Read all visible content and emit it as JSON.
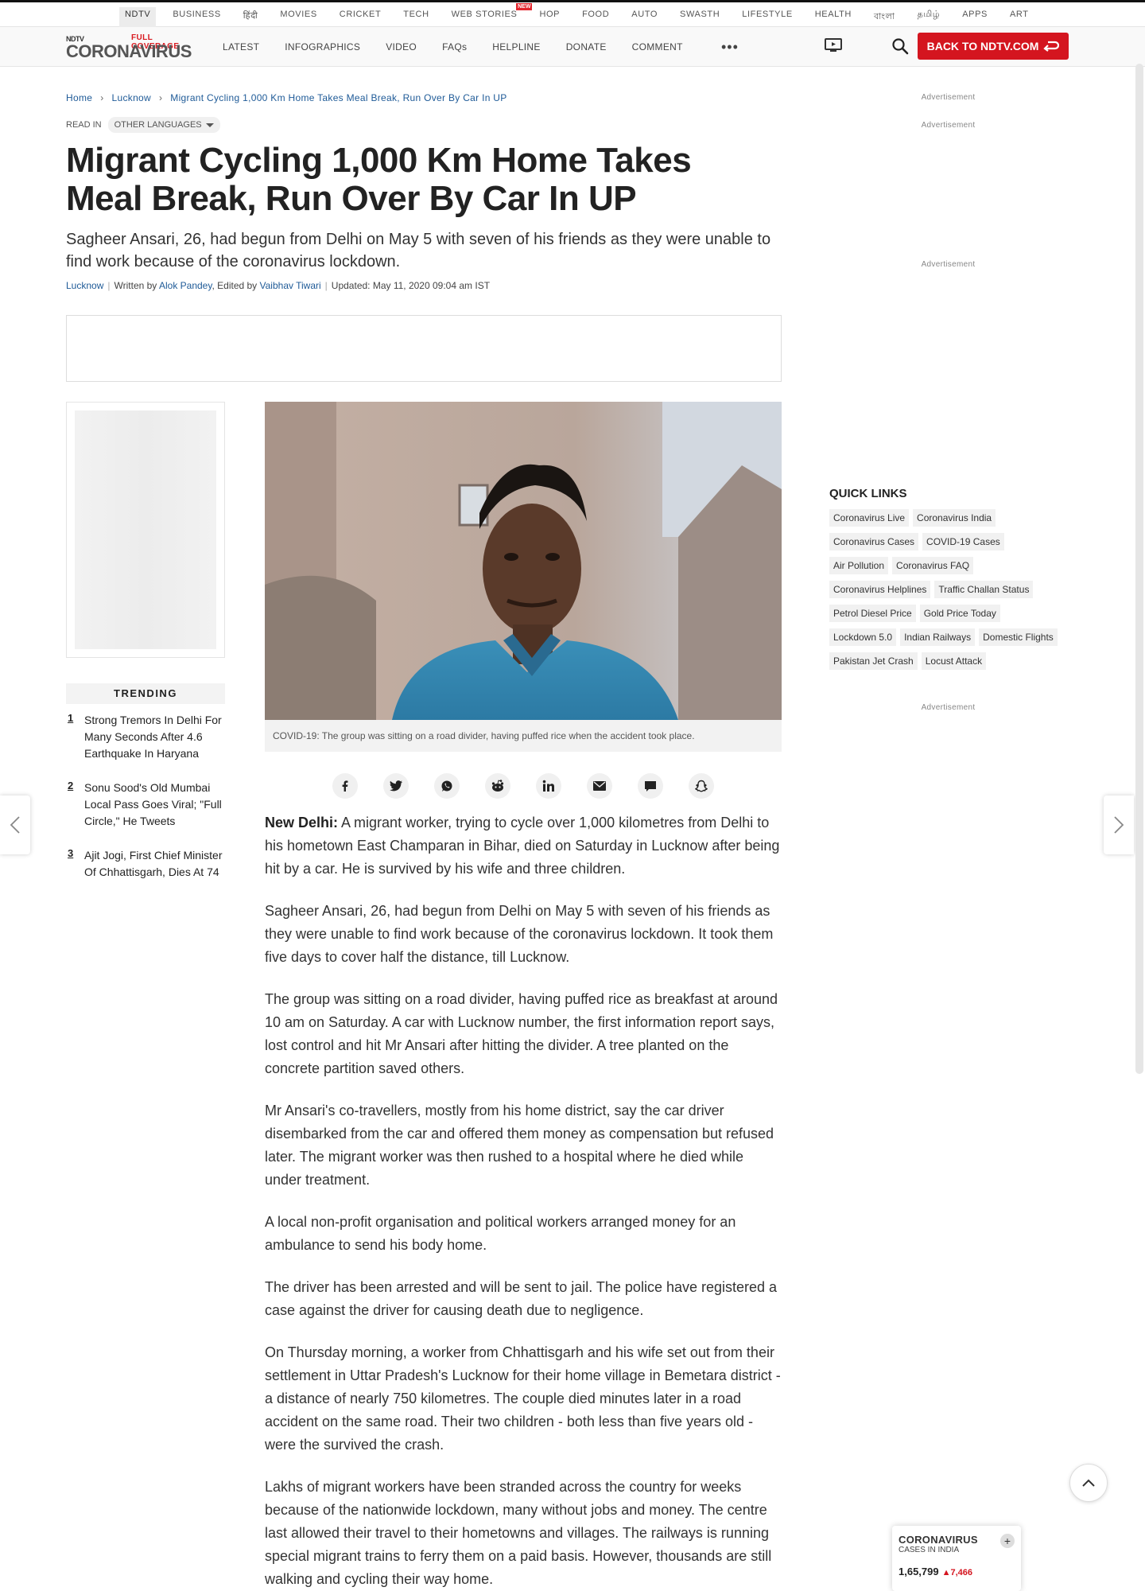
{
  "network_nav": [
    {
      "label": "NDTV",
      "active": true
    },
    {
      "label": "BUSINESS"
    },
    {
      "label": "हिंदी"
    },
    {
      "label": "MOVIES"
    },
    {
      "label": "CRICKET"
    },
    {
      "label": "TECH"
    },
    {
      "label": "WEB STORIES",
      "badge": "NEW"
    },
    {
      "label": "HOP"
    },
    {
      "label": "FOOD"
    },
    {
      "label": "AUTO"
    },
    {
      "label": "SWASTH"
    },
    {
      "label": "LIFESTYLE"
    },
    {
      "label": "HEALTH"
    },
    {
      "label": "বাংলা"
    },
    {
      "label": "தமிழ்"
    },
    {
      "label": "APPS"
    },
    {
      "label": "ART"
    }
  ],
  "header": {
    "logo_ndtv": "NDTV",
    "logo_text": "CORONAVIRUS",
    "logo_tag": "FULL COVERAGE",
    "nav": [
      "LATEST",
      "INFOGRAPHICS",
      "VIDEO",
      "FAQs",
      "HELPLINE",
      "DONATE",
      "COMMENT"
    ],
    "more": "•••",
    "back_button": "BACK TO NDTV.COM"
  },
  "breadcrumb": [
    "Home",
    "Lucknow",
    "Migrant Cycling 1,000 Km Home Takes Meal Break, Run Over By Car In UP"
  ],
  "read_in": {
    "label": "READ IN",
    "dropdown": "OTHER LANGUAGES"
  },
  "article": {
    "headline": "Migrant Cycling 1,000 Km Home Takes Meal Break, Run Over By Car In UP",
    "standfirst": "Sagheer Ansari, 26, had begun from Delhi on May 5 with seven of his friends as they were unable to find work because of the coronavirus lockdown.",
    "byline": {
      "location": "Lucknow",
      "written_prefix": "Written by",
      "author": "Alok Pandey",
      "edited_prefix": ", Edited by",
      "editor": "Vaibhav Tiwari",
      "updated": "Updated: May 11, 2020 09:04 am IST"
    },
    "image_caption": "COVID-19: The group was sitting on a road divider, having puffed rice when the accident took place.",
    "dateline": "New Delhi:",
    "first_paragraph": "A migrant worker, trying to cycle over 1,000 kilometres from Delhi to his hometown East Champaran in Bihar, died on Saturday in Lucknow after being hit by a car. He is survived by his wife and three children.",
    "paragraphs": [
      "Sagheer Ansari, 26, had begun from Delhi on May 5 with seven of his friends as they were unable to find work because of the coronavirus lockdown. It took them five days to cover half the distance, till Lucknow.",
      "The group was sitting on a road divider, having puffed rice as breakfast at around 10 am on Saturday. A car with Lucknow number, the first information report says, lost control and hit Mr Ansari after hitting the divider. A tree planted on the concrete partition saved others.",
      "Mr Ansari's co-travellers, mostly from his home district, say the car driver disembarked from the car and offered them money as compensation but refused later. The migrant worker was then rushed to a hospital where he died while under treatment.",
      "A local non-profit organisation and political workers arranged money for an ambulance to send his body home.",
      "The driver has been arrested and will be sent to jail. The police have registered a case against the driver for causing death due to negligence.",
      "On Thursday morning, a worker from Chhattisgarh and his wife set out from their settlement in Uttar Pradesh's Lucknow for their home village in Bemetara district - a distance of nearly 750 kilometres.  The couple died minutes later in a road accident on the same road. Their two children - both less than five years old - were the survived the crash.",
      "Lakhs of migrant workers have been stranded across the country for weeks because of the nationwide lockdown, many without jobs and money. The centre last allowed their travel to their hometowns and villages. The railways is running special migrant trains to ferry them on a paid basis. However, thousands are still walking and cycling their way home."
    ]
  },
  "share_icons": [
    "facebook-icon",
    "twitter-icon",
    "whatsapp-icon",
    "reddit-icon",
    "linkedin-icon",
    "email-icon",
    "comment-icon",
    "snapchat-icon"
  ],
  "trending": {
    "title": "TRENDING",
    "items": [
      {
        "num": "1",
        "text": "Strong Tremors In Delhi For Many Seconds After 4.6 Earthquake In Haryana"
      },
      {
        "num": "2",
        "text": "Sonu Sood's Old Mumbai Local Pass Goes Viral; \"Full Circle,\" He Tweets"
      },
      {
        "num": "3",
        "text": "Ajit Jogi, First Chief Minister Of Chhattisgarh, Dies At 74"
      }
    ]
  },
  "sidebar": {
    "ad_label": "Advertisement",
    "quick_links_title": "QUICK LINKS",
    "quick_links": [
      "Coronavirus Live",
      "Coronavirus India",
      "Coronavirus Cases",
      "COVID-19 Cases",
      "Air Pollution",
      "Coronavirus FAQ",
      "Coronavirus Helplines",
      "Traffic Challan Status",
      "Petrol Diesel Price",
      "Gold Price Today",
      "Lockdown 5.0",
      "Indian Railways",
      "Domestic Flights",
      "Pakistan Jet Crash",
      "Locust Attack"
    ]
  },
  "covid_widget": {
    "title": "CORONAVIRUS",
    "subtitle": "CASES IN INDIA",
    "total": "1,65,799",
    "delta": "▲7,466",
    "expand": "+"
  },
  "colors": {
    "accent": "#d4151f",
    "link": "#1e5a97"
  }
}
